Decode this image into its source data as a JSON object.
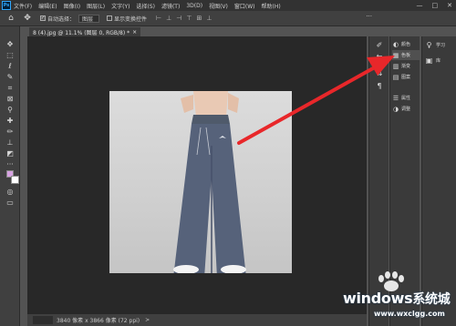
{
  "menubar": {
    "logo": "Ps",
    "items": [
      "文件(F)",
      "编辑(E)",
      "图像(I)",
      "图层(L)",
      "文字(Y)",
      "选择(S)",
      "滤镜(T)",
      "3D(D)",
      "视图(V)",
      "窗口(W)",
      "帮助(H)"
    ],
    "window_controls": [
      "—",
      "□",
      "✕"
    ]
  },
  "options": {
    "auto_select_label": "自动选择：",
    "auto_select_value": "图层",
    "show_transform_label": "显示变换控件",
    "more": "···"
  },
  "document": {
    "tab_title": "8 (4).jpg @ 11.1% (图层 0, RGB/8) *",
    "close": "×"
  },
  "status": {
    "text": "3840 像素 x 3866 像素 (72 ppi)",
    "arrow": ">"
  },
  "panel_list": [
    {
      "icon": "color-icon",
      "label": "颜色"
    },
    {
      "icon": "swatches-icon",
      "label": "色板"
    },
    {
      "icon": "gradient-icon",
      "label": "渐变"
    },
    {
      "icon": "pattern-icon",
      "label": "图案"
    },
    {
      "icon": "properties-icon",
      "label": "属性"
    },
    {
      "icon": "adjustments-icon",
      "label": "调整"
    }
  ],
  "panel_right": [
    {
      "icon": "learn-icon",
      "label": "学习"
    },
    {
      "icon": "libraries-icon",
      "label": "库"
    }
  ],
  "watermark": {
    "title_en": "windows",
    "title_cn": "系统城",
    "url": "www.wxclgg.com"
  },
  "colors": {
    "foreground": "#d7a3e2",
    "background": "#ffffff",
    "arrow": "#e8272a"
  }
}
